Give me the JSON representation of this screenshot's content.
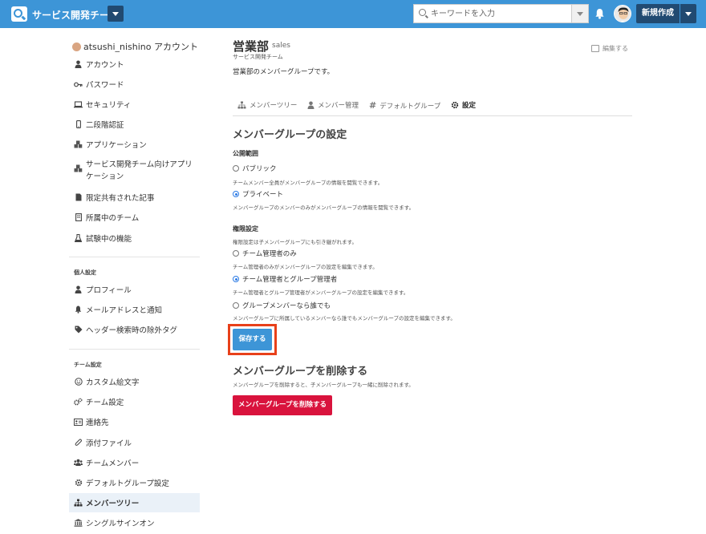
{
  "header": {
    "team_name": "サービス開発チーム",
    "search_placeholder": "キーワードを入力",
    "new_button": "新規作成",
    "brand_color": "#3d95d7",
    "dark_color": "#214a71"
  },
  "sidebar": {
    "account_title": "atsushi_nishino アカウント",
    "account_items": [
      {
        "label": "アカウント",
        "icon": "user-icon"
      },
      {
        "label": "パスワード",
        "icon": "key-icon"
      },
      {
        "label": "セキュリティ",
        "icon": "laptop-icon"
      },
      {
        "label": "二段階認証",
        "icon": "mobile-icon"
      },
      {
        "label": "アプリケーション",
        "icon": "cubes-icon"
      },
      {
        "label": "サービス開発チーム向けアプリケーション",
        "icon": "cubes-icon"
      },
      {
        "label": "限定共有された記事",
        "icon": "file-icon"
      },
      {
        "label": "所属中のチーム",
        "icon": "building-icon"
      },
      {
        "label": "試験中の機能",
        "icon": "flask-icon"
      }
    ],
    "personal_heading": "個人設定",
    "personal_items": [
      {
        "label": "プロフィール",
        "icon": "user-icon"
      },
      {
        "label": "メールアドレスと通知",
        "icon": "bell-icon"
      },
      {
        "label": "ヘッダー検索時の除外タグ",
        "icon": "tag-icon"
      }
    ],
    "team_heading": "チーム設定",
    "team_items": [
      {
        "label": "カスタム絵文字",
        "icon": "smile-icon"
      },
      {
        "label": "チーム設定",
        "icon": "gears-icon"
      },
      {
        "label": "連絡先",
        "icon": "address-card-icon"
      },
      {
        "label": "添付ファイル",
        "icon": "paperclip-icon"
      },
      {
        "label": "チームメンバー",
        "icon": "users-icon"
      },
      {
        "label": "デフォルトグループ設定",
        "icon": "gear-icon"
      },
      {
        "label": "メンバーツリー",
        "icon": "sitemap-icon"
      },
      {
        "label": "シングルサインオン",
        "icon": "bank-icon"
      }
    ]
  },
  "group": {
    "title": "営業部",
    "subtitle": "sales",
    "team": "サービス開発チーム",
    "description": "営業部のメンバーグループです。",
    "edit_label": "編集する"
  },
  "tabs": [
    {
      "label": "メンバーツリー",
      "icon": "sitemap-icon"
    },
    {
      "label": "メンバー管理",
      "icon": "user-icon"
    },
    {
      "label": "デフォルトグループ",
      "icon": "hashtag-icon"
    },
    {
      "label": "設定",
      "icon": "gear-icon"
    }
  ],
  "settings": {
    "title": "メンバーグループの設定",
    "visibility_label": "公開範囲",
    "visibility_options": [
      {
        "label": "パブリック",
        "help": "チームメンバー全員がメンバーグループの情報を閲覧できます。",
        "selected": false
      },
      {
        "label": "プライベート",
        "help": "メンバーグループのメンバーのみがメンバーグループの情報を閲覧できます。",
        "selected": true
      }
    ],
    "permission_label": "権限設定",
    "permission_help": "権限設定は子メンバーグループにも引き継がれます。",
    "permission_options": [
      {
        "label": "チーム管理者のみ",
        "help": "チーム管理者のみがメンバーグループの設定を編集できます。",
        "selected": false
      },
      {
        "label": "チーム管理者とグループ管理者",
        "help": "チーム管理者とグループ管理者がメンバーグループの設定を編集できます。",
        "selected": true
      },
      {
        "label": "グループメンバーなら誰でも",
        "help": "メンバーグループに所属しているメンバーなら誰でもメンバーグループの設定を編集できます。",
        "selected": false
      }
    ],
    "save_button": "保存する"
  },
  "delete": {
    "title": "メンバーグループを削除する",
    "help": "メンバーグループを削除すると、子メンバーグループも一緒に削除されます。",
    "button": "メンバーグループを削除する",
    "color": "#d9133d"
  }
}
